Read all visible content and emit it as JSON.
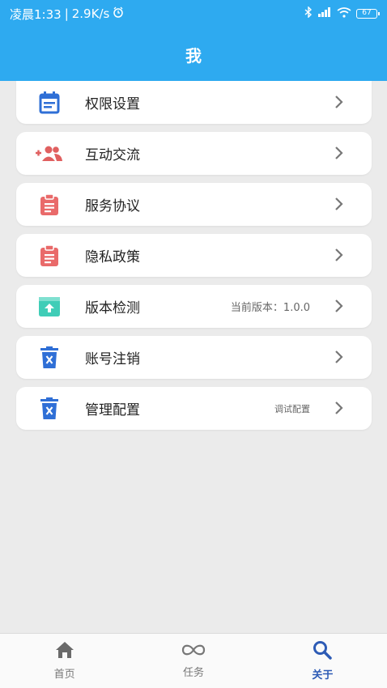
{
  "status_bar": {
    "time": "凌晨1:33",
    "speed": "2.9K/s",
    "battery": "67",
    "icons": [
      "alarm-icon",
      "bluetooth-icon",
      "signal-icon",
      "wifi-icon",
      "battery-icon"
    ]
  },
  "header": {
    "title": "我"
  },
  "menu": {
    "items": [
      {
        "label": "权限设置",
        "extra": "",
        "icon": "calendar-icon",
        "icon_color": "#2f6fd6"
      },
      {
        "label": "互动交流",
        "extra": "",
        "icon": "add-users-icon",
        "icon_color": "#e06060"
      },
      {
        "label": "服务协议",
        "extra": "",
        "icon": "clipboard-icon",
        "icon_color": "#e96a6a"
      },
      {
        "label": "隐私政策",
        "extra": "",
        "icon": "clipboard-icon",
        "icon_color": "#e96a6a"
      },
      {
        "label": "版本检测",
        "extra": "当前版本：1.0.0",
        "icon": "upload-box-icon",
        "icon_color": "#3fcdb7"
      },
      {
        "label": "账号注销",
        "extra": "",
        "icon": "trash-icon",
        "icon_color": "#2f6fd6"
      },
      {
        "label": "管理配置",
        "extra": "调试配置",
        "icon": "trash-icon",
        "icon_color": "#2f6fd6"
      }
    ]
  },
  "tabbar": {
    "tabs": [
      {
        "label": "首页",
        "icon": "home-icon"
      },
      {
        "label": "任务",
        "icon": "infinity-icon"
      },
      {
        "label": "关于",
        "icon": "search-icon",
        "active": true
      }
    ]
  },
  "colors": {
    "primary": "#2eaaf0",
    "active_tab": "#2d5bb5"
  }
}
